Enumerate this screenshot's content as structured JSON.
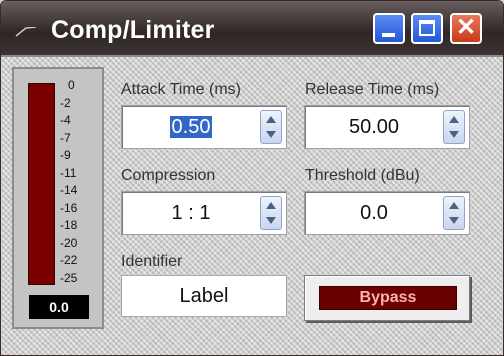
{
  "window": {
    "title": "Comp/Limiter"
  },
  "titlebar": {
    "minimize": "minimize-icon",
    "maximize": "maximize-icon",
    "close": "close-icon",
    "close_glyph": "✕"
  },
  "meter": {
    "scale": [
      "0",
      "-2",
      "-4",
      "-7",
      "-9",
      "-11",
      "-14",
      "-16",
      "-18",
      "-20",
      "-22",
      "-25"
    ],
    "readout": "0.0",
    "level_fraction": 0.0
  },
  "attack": {
    "label": "Attack Time (ms)",
    "value": "0.50"
  },
  "release": {
    "label": "Release Time (ms)",
    "value": "50.00"
  },
  "compression": {
    "label": "Compression",
    "value": "1 : 1"
  },
  "threshold": {
    "label": "Threshold (dBu)",
    "value": "0.0"
  },
  "identifier": {
    "label": "Identifier",
    "value": "Label"
  },
  "bypass": {
    "label": "Bypass"
  },
  "colors": {
    "meter_red": "#7a0000",
    "bypass_red": "#6b0000",
    "title_bg": "#3a3030"
  }
}
